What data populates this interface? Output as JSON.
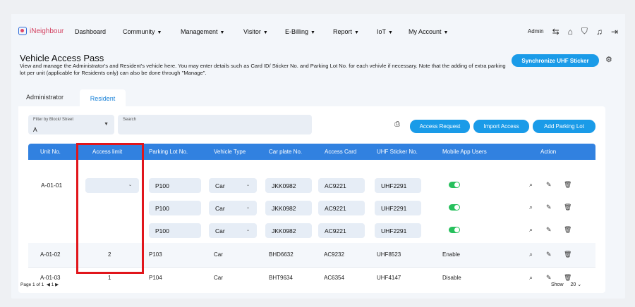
{
  "brand": "iNeighbour",
  "nav": {
    "items": [
      {
        "label": "Dashboard"
      },
      {
        "label": "Community"
      },
      {
        "label": "Management"
      },
      {
        "label": "Visitor"
      },
      {
        "label": "E-Billing"
      },
      {
        "label": "Report"
      },
      {
        "label": "IoT"
      },
      {
        "label": "My Account"
      }
    ],
    "user": "Admin"
  },
  "page": {
    "title": "Vehicle Access Pass",
    "description": "View and manage the Administrator's and Resident's vehicle here. You may enter details such as Card ID/ Sticker No. and Parking Lot No. for each vehivle if necessary. Note that the adding of extra parking lot per unit (applicable for Residents only) can also be done through \"Manage\".",
    "sync_button": "Synchronize UHF Sticker"
  },
  "tabs": [
    {
      "label": "Administrator"
    },
    {
      "label": "Resident"
    }
  ],
  "filter": {
    "label": "Filter by Block/ Street",
    "value": "A"
  },
  "search": {
    "label": "Search"
  },
  "buttons": {
    "access_request": "Access Request",
    "import_access": "Import Access",
    "add_parking_lot": "Add Parking Lot"
  },
  "table": {
    "headers": [
      "Unit No.",
      "Access limit",
      "Parking Lot No.",
      "Vehicle Type",
      "Car plate No.",
      "Access Card",
      "UHF Sticker No.",
      "Mobile App Users",
      "Action"
    ],
    "edit_row": {
      "unit": "A-01-01",
      "lines": [
        {
          "parking": "P100",
          "type": "Car",
          "plate": "JKK0982",
          "card": "AC9221",
          "uhf": "UHF2291"
        },
        {
          "parking": "P100",
          "type": "Car",
          "plate": "JKK0982",
          "card": "AC9221",
          "uhf": "UHF2291"
        },
        {
          "parking": "P100",
          "type": "Car",
          "plate": "JKK0982",
          "card": "AC9221",
          "uhf": "UHF2291"
        }
      ]
    },
    "rows": [
      {
        "unit": "A-01-02",
        "limit": "2",
        "parking": "P103",
        "type": "Car",
        "plate": "BHD6632",
        "card": "AC9232",
        "uhf": "UHF8523",
        "mobile": "Enable"
      },
      {
        "unit": "A-01-03",
        "limit": "1",
        "parking": "P104",
        "type": "Car",
        "plate": "BHT9634",
        "card": "AC6354",
        "uhf": "UHF4147",
        "mobile": "Disable"
      }
    ]
  },
  "pager": {
    "text": "Page 1 of 1",
    "current": "1"
  },
  "show": {
    "label": "Show",
    "value": "20"
  },
  "colors": {
    "primary": "#1a9be8",
    "header": "#3181e0",
    "highlight": "#e1151b",
    "toggle_on": "#26c05c"
  }
}
